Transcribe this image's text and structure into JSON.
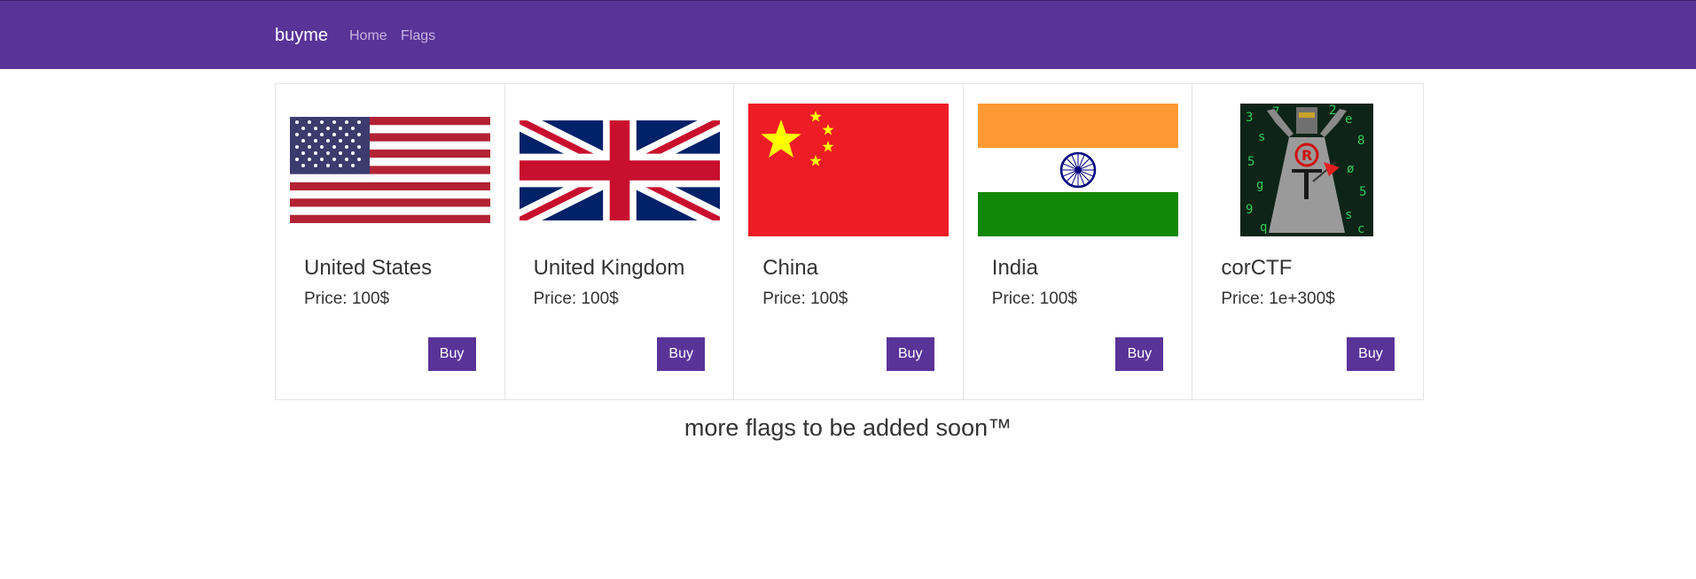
{
  "navbar": {
    "brand": "buyme",
    "links": [
      "Home",
      "Flags"
    ]
  },
  "flags": [
    {
      "name": "United States",
      "price": "Price: 100$",
      "buy": "Buy",
      "icon": "us-flag-icon"
    },
    {
      "name": "United Kingdom",
      "price": "Price: 100$",
      "buy": "Buy",
      "icon": "uk-flag-icon"
    },
    {
      "name": "China",
      "price": "Price: 100$",
      "buy": "Buy",
      "icon": "china-flag-icon"
    },
    {
      "name": "India",
      "price": "Price: 100$",
      "buy": "Buy",
      "icon": "india-flag-icon"
    },
    {
      "name": "corCTF",
      "price": "Price: 1e+300$",
      "buy": "Buy",
      "icon": "corctf-flag-icon"
    }
  ],
  "footer": {
    "text": "more flags to be added soon™"
  },
  "colors": {
    "navbar": "#5a3399",
    "button": "#5a3399"
  }
}
